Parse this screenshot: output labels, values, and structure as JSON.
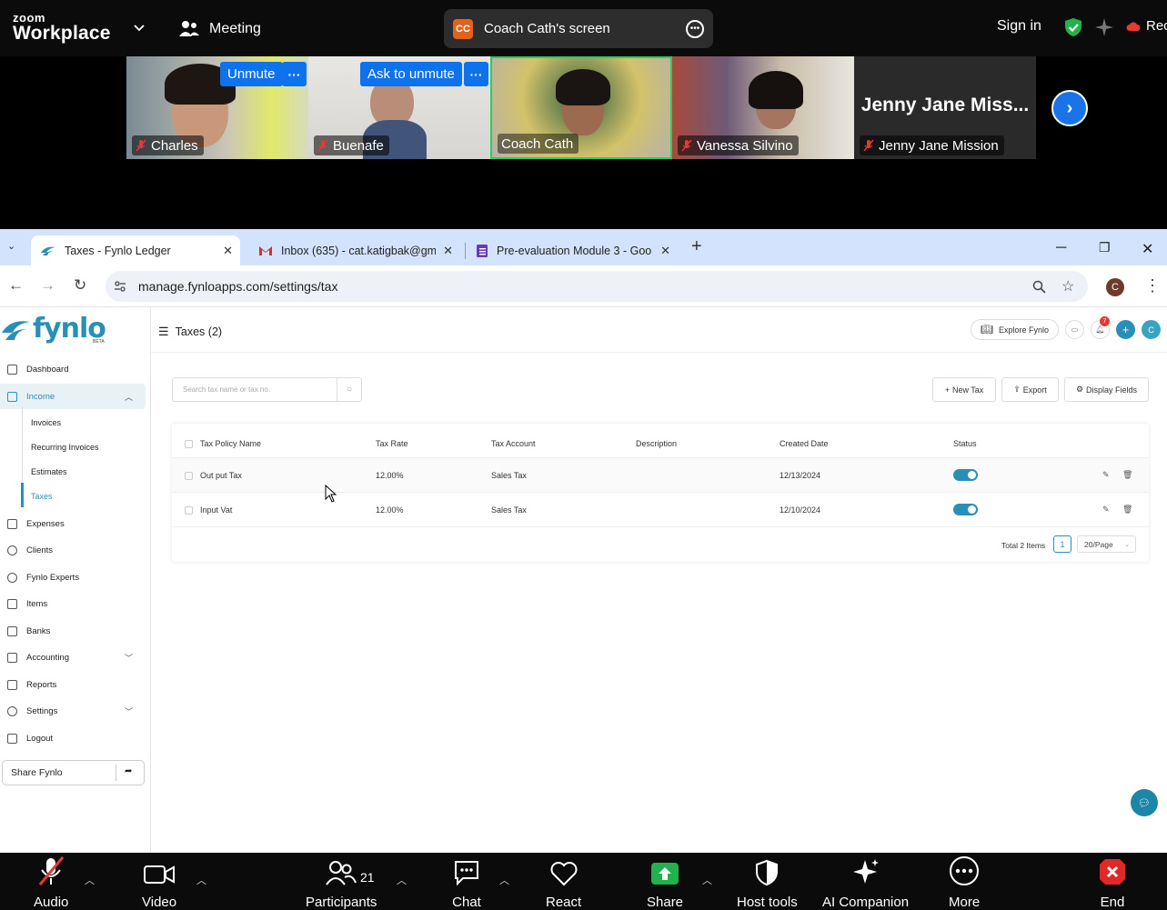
{
  "zoom": {
    "logo_top": "zoom",
    "logo_bottom": "Workplace",
    "meeting_label": "Meeting",
    "share_badge": "CC",
    "share_label": "Coach Cath's screen",
    "signin_label": "Sign in",
    "rec_label": "Rec",
    "participants": [
      {
        "name": "Charles",
        "muted": true,
        "action": "Unmute"
      },
      {
        "name": "Buenafe",
        "muted": true,
        "action": "Ask to unmute"
      },
      {
        "name": "Coach Cath",
        "muted": false,
        "active_speaker": true
      },
      {
        "name": "Vanessa Silvino",
        "muted": true
      },
      {
        "name": "Jenny Jane Mission",
        "muted": true,
        "placeholder_text": "Jenny  Jane  Miss..."
      }
    ],
    "toolbar": {
      "audio": "Audio",
      "video": "Video",
      "participants": "Participants",
      "participants_count": "21",
      "chat": "Chat",
      "react": "React",
      "share": "Share",
      "host_tools": "Host tools",
      "ai_companion": "AI Companion",
      "more": "More",
      "end": "End"
    }
  },
  "browser": {
    "tabs": [
      {
        "title": "Taxes - Fynlo Ledger",
        "active": true
      },
      {
        "title": "Inbox (635) - cat.katigbak@gm",
        "active": false
      },
      {
        "title": "Pre-evaluation Module 3 - Goo",
        "active": false
      }
    ],
    "url": "manage.fynloapps.com/settings/tax",
    "profile_initial": "C"
  },
  "app": {
    "logo": "fynlo",
    "logo_badge": "BETA",
    "sidebar": {
      "items": [
        {
          "label": "Dashboard"
        },
        {
          "label": "Income",
          "expanded": true
        },
        {
          "label": "Expenses"
        },
        {
          "label": "Clients"
        },
        {
          "label": "Fynlo Experts"
        },
        {
          "label": "Items"
        },
        {
          "label": "Banks"
        },
        {
          "label": "Accounting",
          "has_children": true
        },
        {
          "label": "Reports"
        },
        {
          "label": "Settings",
          "has_children": true
        },
        {
          "label": "Logout"
        }
      ],
      "income_sub": [
        "Invoices",
        "Recurring Invoices",
        "Estimates",
        "Taxes"
      ],
      "active_sub": "Taxes",
      "share_label": "Share Fynlo"
    },
    "header": {
      "title": "Taxes (2)",
      "explore_label": "Explore Fynlo",
      "notification_count": "7",
      "avatar_initial": "C"
    },
    "search_placeholder": "Search tax name or tax no.",
    "actions": {
      "new_tax": "New Tax",
      "export": "Export",
      "display_fields": "Display Fields"
    },
    "table": {
      "columns": [
        "Tax Policy Name",
        "Tax Rate",
        "Tax Account",
        "Description",
        "Created Date",
        "Status"
      ],
      "rows": [
        {
          "name": "Out put Tax",
          "rate": "12.00%",
          "account": "Sales Tax",
          "description": "",
          "created": "12/13/2024",
          "status_on": true
        },
        {
          "name": "Input Vat",
          "rate": "12.00%",
          "account": "Sales Tax",
          "description": "",
          "created": "12/10/2024",
          "status_on": true
        }
      ]
    },
    "pagination": {
      "total": "Total 2 Items",
      "page": "1",
      "page_size": "20/Page"
    }
  }
}
